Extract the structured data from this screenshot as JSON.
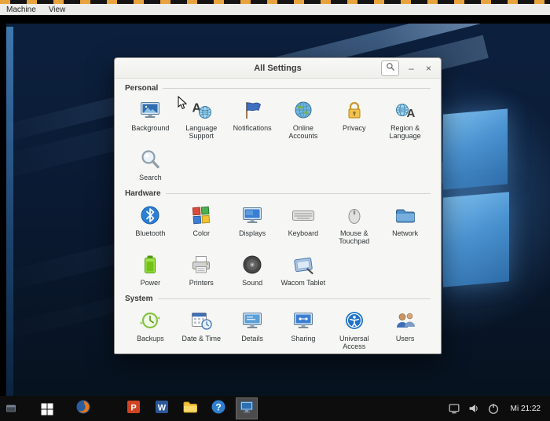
{
  "menubar": {
    "items": [
      {
        "label": "Machine"
      },
      {
        "label": "View"
      }
    ]
  },
  "window": {
    "title": "All Settings",
    "controls": {
      "search_icon": "magnifier-icon",
      "minimize_label": "–",
      "close_label": "×"
    },
    "sections": [
      {
        "title": "Personal",
        "items": [
          {
            "label": "Background",
            "icon": "background-monitor-icon"
          },
          {
            "label": "Language Support",
            "icon": "language-support-icon"
          },
          {
            "label": "Notifications",
            "icon": "notifications-flag-icon"
          },
          {
            "label": "Online Accounts",
            "icon": "online-accounts-globe-icon"
          },
          {
            "label": "Privacy",
            "icon": "privacy-lock-icon"
          },
          {
            "label": "Region & Language",
            "icon": "region-language-icon"
          },
          {
            "label": "Search",
            "icon": "search-magnifier-icon"
          }
        ]
      },
      {
        "title": "Hardware",
        "items": [
          {
            "label": "Bluetooth",
            "icon": "bluetooth-icon"
          },
          {
            "label": "Color",
            "icon": "color-profile-icon"
          },
          {
            "label": "Displays",
            "icon": "displays-monitor-icon"
          },
          {
            "label": "Keyboard",
            "icon": "keyboard-icon"
          },
          {
            "label": "Mouse & Touchpad",
            "icon": "mouse-icon"
          },
          {
            "label": "Network",
            "icon": "network-folder-icon"
          },
          {
            "label": "Power",
            "icon": "power-battery-icon"
          },
          {
            "label": "Printers",
            "icon": "printer-icon"
          },
          {
            "label": "Sound",
            "icon": "sound-speaker-icon"
          },
          {
            "label": "Wacom Tablet",
            "icon": "wacom-tablet-icon"
          }
        ]
      },
      {
        "title": "System",
        "items": [
          {
            "label": "Backups",
            "icon": "backups-icon"
          },
          {
            "label": "Date & Time",
            "icon": "date-time-icon"
          },
          {
            "label": "Details",
            "icon": "details-monitor-icon"
          },
          {
            "label": "Sharing",
            "icon": "sharing-monitor-icon"
          },
          {
            "label": "Universal Access",
            "icon": "universal-access-icon"
          },
          {
            "label": "Users",
            "icon": "users-icon"
          }
        ]
      }
    ]
  },
  "taskbar": {
    "corner_icon": "window-icon",
    "start_icon": "windows-start-icon",
    "apps": [
      {
        "name": "firefox",
        "icon": "firefox-icon",
        "active": false
      },
      {
        "name": "powerpoint",
        "icon": "powerpoint-icon",
        "active": false
      },
      {
        "name": "word",
        "icon": "word-icon",
        "active": false
      },
      {
        "name": "file-explorer",
        "icon": "folder-icon",
        "active": false
      },
      {
        "name": "help",
        "icon": "help-icon",
        "active": false
      },
      {
        "name": "settings-vm-window",
        "icon": "display-window-icon",
        "active": true
      }
    ],
    "tray": {
      "icons": [
        {
          "name": "display-tray-icon"
        },
        {
          "name": "volume-tray-icon"
        },
        {
          "name": "power-tray-icon"
        }
      ],
      "clock": "Mi 21:22"
    }
  },
  "colors": {
    "desktop_blue": "#0a1a33",
    "logo_blue": "#4a92d0",
    "taskbar_black": "#0d0d0d",
    "strip_orange": "#e8a33d"
  }
}
